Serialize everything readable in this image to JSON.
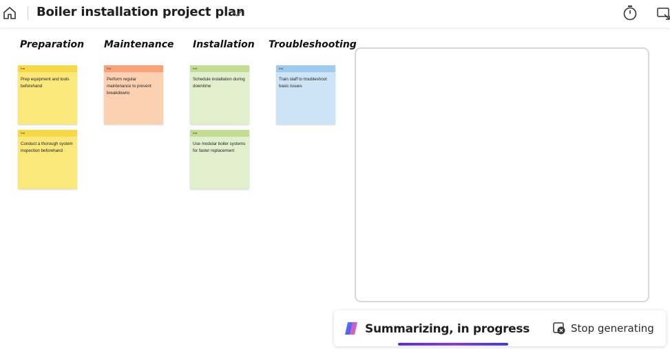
{
  "header": {
    "title": "Boiler installation project plan"
  },
  "columns": [
    {
      "title": "Preparation",
      "color": "#fbe87a",
      "strip_color": "#f7d948",
      "notes": [
        {
          "author": "Kat",
          "text": "Prep equipment and tools beforehand"
        },
        {
          "author": "Kat",
          "text": "Conduct a thorough system inspection beforehand"
        }
      ]
    },
    {
      "title": "Maintenance",
      "color": "#fdd0b1",
      "strip_color": "#f8a27a",
      "notes": [
        {
          "author": "Kat",
          "text": "Perform regular maintenance to prevent breakdowns"
        }
      ]
    },
    {
      "title": "Installation",
      "color": "#e1efcc",
      "strip_color": "#c3de94",
      "notes": [
        {
          "author": "Kat",
          "text": "Schedule installation during downtime"
        },
        {
          "author": "Kat",
          "text": "Use modular boiler systems for faster replacement"
        }
      ]
    },
    {
      "title": "Troubleshooting",
      "color": "#cde4f6",
      "strip_color": "#9fcaee",
      "notes": [
        {
          "author": "Kat",
          "text": "Train staff to troubleshoot basic issues"
        }
      ]
    }
  ],
  "status": {
    "text": "Summarizing, in progress",
    "stop_label": "Stop generating"
  },
  "icons": {
    "home": "home-icon",
    "title_dropdown": "chevron-down-icon",
    "timer": "timer-icon",
    "share": "present-icon",
    "copilot": "copilot-icon",
    "stop": "stop-icon"
  }
}
